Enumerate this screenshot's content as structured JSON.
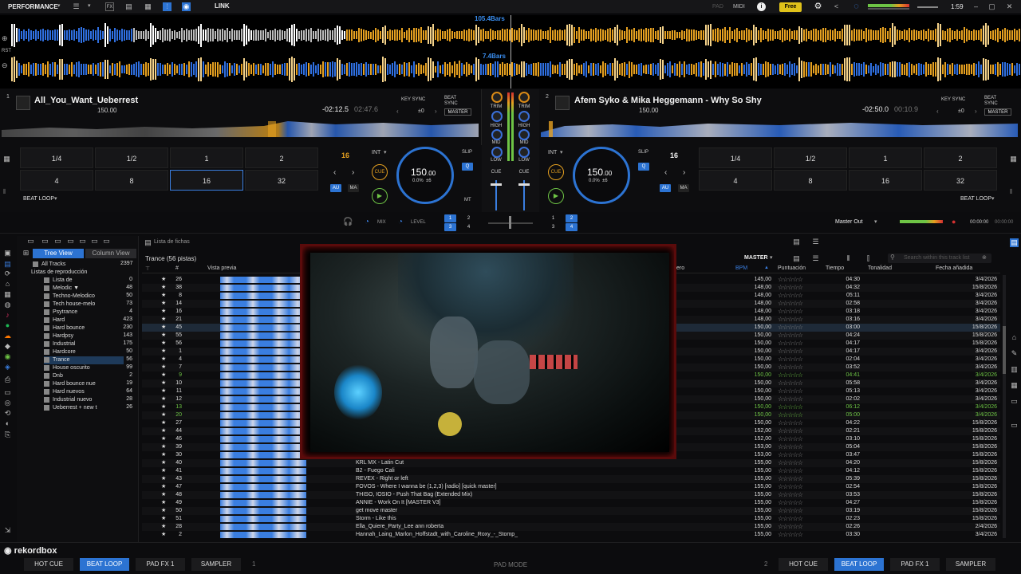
{
  "top_bar": {
    "mode": "PERFORMANCE",
    "link": "LINK",
    "pad_label": "PAD",
    "midi_label": "MIDI",
    "free_label": "Free",
    "clock": "1:59"
  },
  "waveform_overview": {
    "bars_label_1": "105.4Bars",
    "bars_label_2": "7.4Bars",
    "rst": "RST"
  },
  "deck1": {
    "number": "1",
    "title": "All_You_Want_Ueberrest",
    "bpm": "150.00",
    "remaining": "-02:12.5",
    "elapsed": "02:47.6",
    "key_sync": "KEY SYNC",
    "beat_sync": "BEAT SYNC",
    "offset": "±0",
    "master": "MASTER",
    "loop_value": "16",
    "int": "INT",
    "cue": "CUE",
    "tempo": "150",
    "tempo_dec": ".00",
    "pitch": "0.0%",
    "pitch_range": "±6",
    "slip": "SLIP",
    "q": "Q",
    "au": "AU",
    "ma": "MA",
    "mt": "MT",
    "beat_loop": "BEAT LOOP",
    "pads": [
      "1/4",
      "1/2",
      "1",
      "2",
      "4",
      "8",
      "16",
      "32"
    ]
  },
  "deck2": {
    "number": "2",
    "title": "Afem Syko & Mika Heggemann - Why So Shy",
    "bpm": "150.00",
    "remaining": "-02:50.0",
    "elapsed": "00:10.9",
    "key_sync": "KEY SYNC",
    "beat_sync": "BEAT SYNC",
    "offset": "±0",
    "master": "MASTER",
    "loop_value": "16",
    "int": "INT",
    "cue": "CUE",
    "tempo": "150",
    "tempo_dec": ".00",
    "pitch": "0.0%",
    "pitch_range": "±6",
    "slip": "SLIP",
    "q": "Q",
    "au": "AU",
    "ma": "MA",
    "mt": "MT",
    "beat_loop": "BEAT LOOP",
    "pads": [
      "1/4",
      "1/2",
      "1",
      "2",
      "4",
      "8",
      "16",
      "32"
    ]
  },
  "mixer": {
    "trim": "TRIM",
    "high": "HIGH",
    "mid": "MID",
    "low": "LOW",
    "cue": "CUE",
    "mix": "MIX",
    "level": "LEVEL",
    "master_out": "Master Out",
    "rec_time": "00:00:00",
    "rec_time2": "00:00:00"
  },
  "browser": {
    "tab_tree": "Tree View",
    "tab_column": "Column View",
    "lista_fichas": "Lista de fichas",
    "playlist_header": "Trance (56 pistas)",
    "master_label": "MASTER",
    "search_placeholder": "Search within this track list",
    "tree": [
      {
        "label": "All Tracks",
        "count": "2397"
      },
      {
        "label": "Listas de reproducción",
        "count": ""
      },
      {
        "label": "Lista de",
        "count": "0"
      },
      {
        "label": "Melodic ▼",
        "count": "48"
      },
      {
        "label": "Techno-Melodico",
        "count": "50"
      },
      {
        "label": "Tech house-melo",
        "count": "73"
      },
      {
        "label": "Psytrance",
        "count": "4"
      },
      {
        "label": "Hard",
        "count": "423"
      },
      {
        "label": "Hard bounce",
        "count": "230"
      },
      {
        "label": "Hardpsy",
        "count": "143"
      },
      {
        "label": "Industrial",
        "count": "175"
      },
      {
        "label": "Hardcore",
        "count": "50"
      },
      {
        "label": "Trance",
        "count": "56"
      },
      {
        "label": "House oscurito",
        "count": "99"
      },
      {
        "label": "Dnb",
        "count": "2"
      },
      {
        "label": "Hard bounce nue",
        "count": "19"
      },
      {
        "label": "Hard nuevos",
        "count": "64"
      },
      {
        "label": "Industrial nuevo",
        "count": "28"
      },
      {
        "label": "Ueberrest + new t",
        "count": "26"
      }
    ],
    "columns": {
      "num": "#",
      "preview": "Vista previa",
      "genre": "ero",
      "bpm": "BPM",
      "rating": "Puntuación",
      "time": "Tiempo",
      "key": "Tonalidad",
      "date": "Fecha añadida"
    },
    "rows": [
      {
        "num": "26",
        "title": "",
        "bpm": "145,00",
        "time": "04:30",
        "date": "3/4/2026",
        "state": ""
      },
      {
        "num": "38",
        "title": "",
        "bpm": "148,00",
        "time": "04:32",
        "date": "15/8/2026",
        "state": ""
      },
      {
        "num": "8",
        "title": "",
        "bpm": "148,00",
        "time": "05:11",
        "date": "3/4/2026",
        "state": ""
      },
      {
        "num": "14",
        "title": "",
        "bpm": "148,00",
        "time": "02:58",
        "date": "3/4/2026",
        "state": ""
      },
      {
        "num": "16",
        "title": "",
        "bpm": "148,00",
        "time": "03:18",
        "date": "3/4/2026",
        "state": ""
      },
      {
        "num": "21",
        "title": "",
        "bpm": "148,00",
        "time": "03:16",
        "date": "3/4/2026",
        "state": ""
      },
      {
        "num": "45",
        "title": "",
        "bpm": "150,00",
        "time": "03:00",
        "date": "15/8/2026",
        "state": "sel"
      },
      {
        "num": "55",
        "title": "",
        "bpm": "150,00",
        "time": "04:24",
        "date": "15/8/2026",
        "state": ""
      },
      {
        "num": "56",
        "title": "",
        "bpm": "150,00",
        "time": "04:17",
        "date": "15/8/2026",
        "state": ""
      },
      {
        "num": "1",
        "title": "",
        "bpm": "150,00",
        "time": "04:17",
        "date": "3/4/2026",
        "state": ""
      },
      {
        "num": "4",
        "title": "",
        "bpm": "150,00",
        "time": "02:04",
        "date": "3/4/2026",
        "state": ""
      },
      {
        "num": "7",
        "title": "",
        "bpm": "150,00",
        "time": "03:52",
        "date": "3/4/2026",
        "state": ""
      },
      {
        "num": "9",
        "title": "",
        "bpm": "150,00",
        "time": "04:41",
        "date": "3/4/2026",
        "state": "g"
      },
      {
        "num": "10",
        "title": "",
        "bpm": "150,00",
        "time": "05:58",
        "date": "3/4/2026",
        "state": ""
      },
      {
        "num": "11",
        "title": "",
        "bpm": "150,00",
        "time": "05:13",
        "date": "3/4/2026",
        "state": ""
      },
      {
        "num": "12",
        "title": "",
        "bpm": "150,00",
        "time": "02:02",
        "date": "3/4/2026",
        "state": ""
      },
      {
        "num": "13",
        "title": "",
        "bpm": "150,00",
        "time": "06:12",
        "date": "3/4/2026",
        "state": "g"
      },
      {
        "num": "20",
        "title": "",
        "bpm": "150,00",
        "time": "05:00",
        "date": "3/4/2026",
        "state": "g"
      },
      {
        "num": "27",
        "title": "",
        "bpm": "150,00",
        "time": "04:22",
        "date": "15/8/2026",
        "state": ""
      },
      {
        "num": "44",
        "title": "",
        "bpm": "152,00",
        "time": "02:21",
        "date": "15/8/2026",
        "state": ""
      },
      {
        "num": "46",
        "title": "",
        "bpm": "152,00",
        "time": "03:10",
        "date": "15/8/2026",
        "state": ""
      },
      {
        "num": "39",
        "title": "",
        "bpm": "153,00",
        "time": "05:04",
        "date": "15/8/2026",
        "state": ""
      },
      {
        "num": "30",
        "title": "",
        "bpm": "153,00",
        "time": "03:47",
        "date": "15/8/2026",
        "state": ""
      },
      {
        "num": "40",
        "title": "KRL MX - Latin Cut",
        "bpm": "155,00",
        "time": "04:20",
        "date": "15/8/2026",
        "state": ""
      },
      {
        "num": "41",
        "title": "B2 - Fuego Cali",
        "bpm": "155,00",
        "time": "04:12",
        "date": "15/8/2026",
        "state": ""
      },
      {
        "num": "43",
        "title": "REVEX - Right or left",
        "bpm": "155,00",
        "time": "05:39",
        "date": "15/8/2026",
        "state": ""
      },
      {
        "num": "47",
        "title": "FOVOS - Where I wanna be (1,2,3) [radio] [quick master]",
        "bpm": "155,00",
        "time": "02:54",
        "date": "15/8/2026",
        "state": ""
      },
      {
        "num": "48",
        "title": "THISO, IOSIO - Push That Bag (Extended Mix)",
        "bpm": "155,00",
        "time": "03:53",
        "date": "15/8/2026",
        "state": ""
      },
      {
        "num": "49",
        "title": "ANNIE - Work On It [MASTER V3]",
        "bpm": "155,00",
        "time": "04:27",
        "date": "15/8/2026",
        "state": ""
      },
      {
        "num": "50",
        "title": "get move master",
        "bpm": "155,00",
        "time": "03:19",
        "date": "15/8/2026",
        "state": ""
      },
      {
        "num": "51",
        "title": "Storm - Like this",
        "bpm": "155,00",
        "time": "02:23",
        "date": "15/8/2026",
        "state": ""
      },
      {
        "num": "28",
        "title": "Ella_Quiere_Party_Lee ann roberta",
        "bpm": "155,00",
        "time": "02:26",
        "date": "2/4/2026",
        "state": ""
      },
      {
        "num": "2",
        "title": "Hannah_Laing_Marlon_Hoffstadt_with_Caroline_Roxy_-_Stomp_",
        "bpm": "155,00",
        "time": "03:30",
        "date": "3/4/2026",
        "state": ""
      }
    ]
  },
  "bottom": {
    "logo": "rekordbox",
    "hot_cue": "HOT CUE",
    "beat_loop": "BEAT LOOP",
    "pad_fx": "PAD FX 1",
    "sampler": "SAMPLER",
    "deck1_num": "1",
    "deck2_num": "2",
    "pad_mode": "PAD MODE"
  },
  "colors": {
    "accent_blue": "#2c73d2",
    "wave_orange": "#e5a020",
    "wave_blue": "#2f6fe0",
    "free_badge": "#e0c21a",
    "green_row": "#6ec445"
  }
}
